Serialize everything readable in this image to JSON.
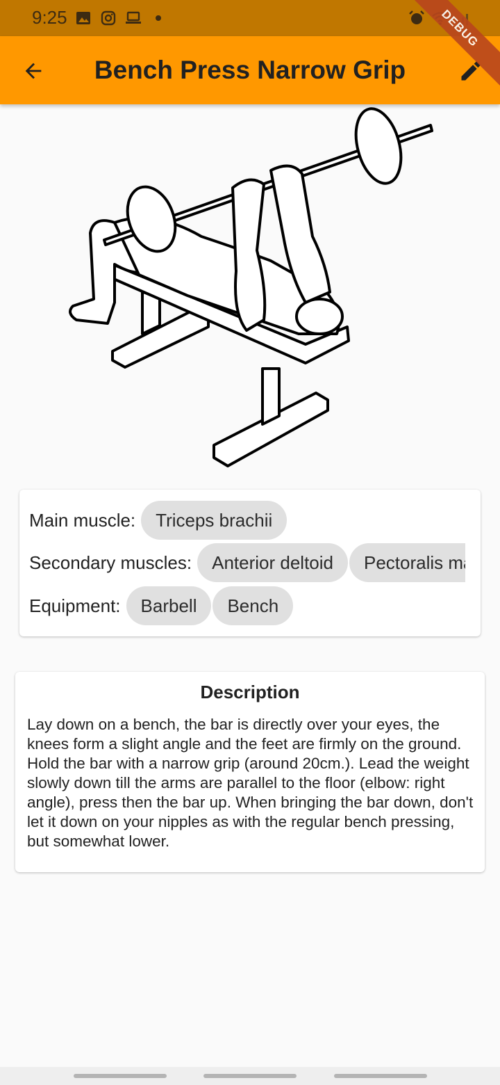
{
  "status_bar": {
    "time": "9:25",
    "left_icons": [
      "image-icon",
      "instagram-icon",
      "laptop-icon",
      "dot-icon"
    ],
    "right_icons": [
      "alarm-icon",
      "wifi-icon",
      "signal-icon"
    ]
  },
  "app_bar": {
    "title": "Bench Press Narrow Grip",
    "back_icon": "arrow-back-icon",
    "edit_icon": "pencil-icon",
    "background": "#ff9800"
  },
  "debug_banner": "DEBUG",
  "exercise": {
    "image_alt": "bench-press-narrow-grip-illustration"
  },
  "muscles": {
    "main_label": "Main muscle:",
    "main": [
      "Triceps brachii"
    ],
    "secondary_label": "Secondary muscles:",
    "secondary": [
      "Anterior deltoid",
      "Pectoralis major"
    ],
    "equipment_label": "Equipment:",
    "equipment": [
      "Barbell",
      "Bench"
    ]
  },
  "description": {
    "title": "Description",
    "text": "Lay down on a bench, the bar is directly over your eyes, the knees form a slight angle and the feet are firmly on the ground. Hold the bar with a narrow grip (around 20cm.). Lead the weight slowly down till the arms are parallel to the floor (elbow: right angle), press then the bar up. When bringing the bar down, don't let it down on your nipples as with the regular bench pressing, but somewhat lower."
  }
}
